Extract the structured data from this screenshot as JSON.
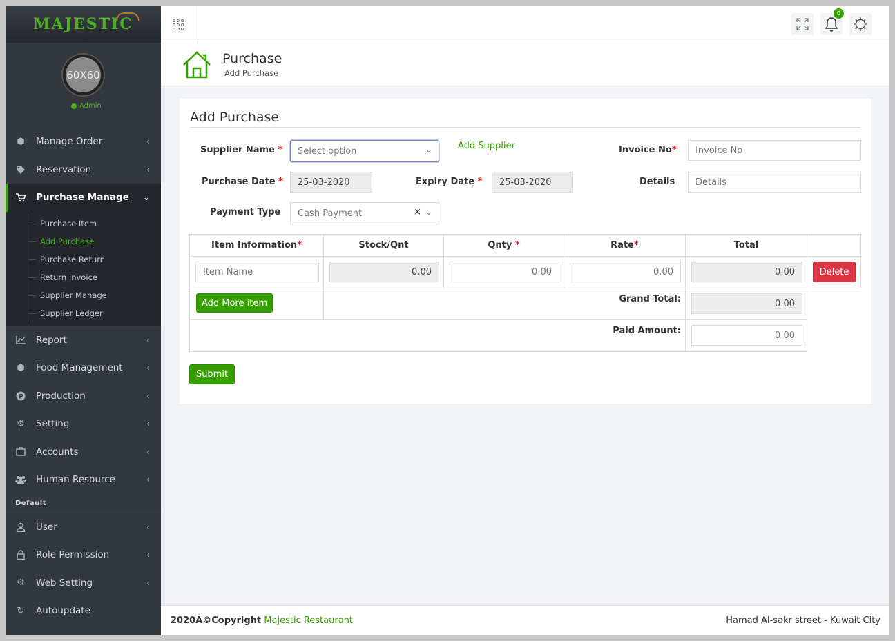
{
  "brand": {
    "name": "MAJESTIC"
  },
  "profile": {
    "avatar_text": "60X60",
    "role": "Admin"
  },
  "sidebar": {
    "items": [
      {
        "label": "Manage Order",
        "icon": "cube-icon"
      },
      {
        "label": "Reservation",
        "icon": "tag-icon"
      },
      {
        "label": "Purchase Manage",
        "icon": "cart-icon"
      }
    ],
    "submenu": [
      "Purchase Item",
      "Add Purchase",
      "Purchase Return",
      "Return Invoice",
      "Supplier Manage",
      "Supplier Ledger"
    ],
    "items2": [
      {
        "label": "Report",
        "icon": "chart-line-icon"
      },
      {
        "label": "Food Management",
        "icon": "box-icon"
      },
      {
        "label": "Production",
        "icon": "production-icon"
      },
      {
        "label": "Setting",
        "icon": "gear-icon"
      },
      {
        "label": "Accounts",
        "icon": "briefcase-icon"
      },
      {
        "label": "Human Resource",
        "icon": "users-icon"
      }
    ],
    "section": "Default",
    "items3": [
      {
        "label": "User",
        "icon": "user-icon"
      },
      {
        "label": "Role Permission",
        "icon": "lock-icon"
      },
      {
        "label": "Web Setting",
        "icon": "cog-icon"
      },
      {
        "label": "Autoupdate",
        "icon": "refresh-icon"
      }
    ]
  },
  "topbar": {
    "notification_count": "0"
  },
  "header": {
    "title": "Purchase",
    "subtitle": "Add Purchase"
  },
  "form": {
    "title": "Add Purchase",
    "supplier_label": "Supplier Name",
    "supplier_placeholder": "Select option",
    "add_supplier": "Add Supplier",
    "invoice_label": "Invoice No",
    "invoice_placeholder": "Invoice No",
    "purchase_date_label": "Purchase Date",
    "purchase_date": "25-03-2020",
    "expiry_date_label": "Expiry Date",
    "expiry_date": "25-03-2020",
    "details_label": "Details",
    "details_placeholder": "Details",
    "payment_label": "Payment Type",
    "payment_value": "Cash Payment",
    "required": "*"
  },
  "table": {
    "headers": [
      "Item Information",
      "Stock/Qnt",
      "Qnty",
      "Rate",
      "Total"
    ],
    "row": {
      "item_placeholder": "Item Name",
      "stock": "0.00",
      "qnty": "0.00",
      "rate": "0.00",
      "total": "0.00"
    },
    "delete": "Delete",
    "add_more": "Add More item",
    "grand_total_label": "Grand Total:",
    "grand_total": "0.00",
    "paid_label": "Paid Amount:",
    "paid_placeholder": "0.00"
  },
  "submit": "Submit",
  "footer": {
    "copy": "2020Â©Copyright",
    "brand": "Majestic Restaurant",
    "address": "Hamad Al-sakr street - Kuwait City"
  },
  "colors": {
    "accent": "#37a000",
    "sidebar": "#32383e",
    "danger": "#dc3545"
  }
}
